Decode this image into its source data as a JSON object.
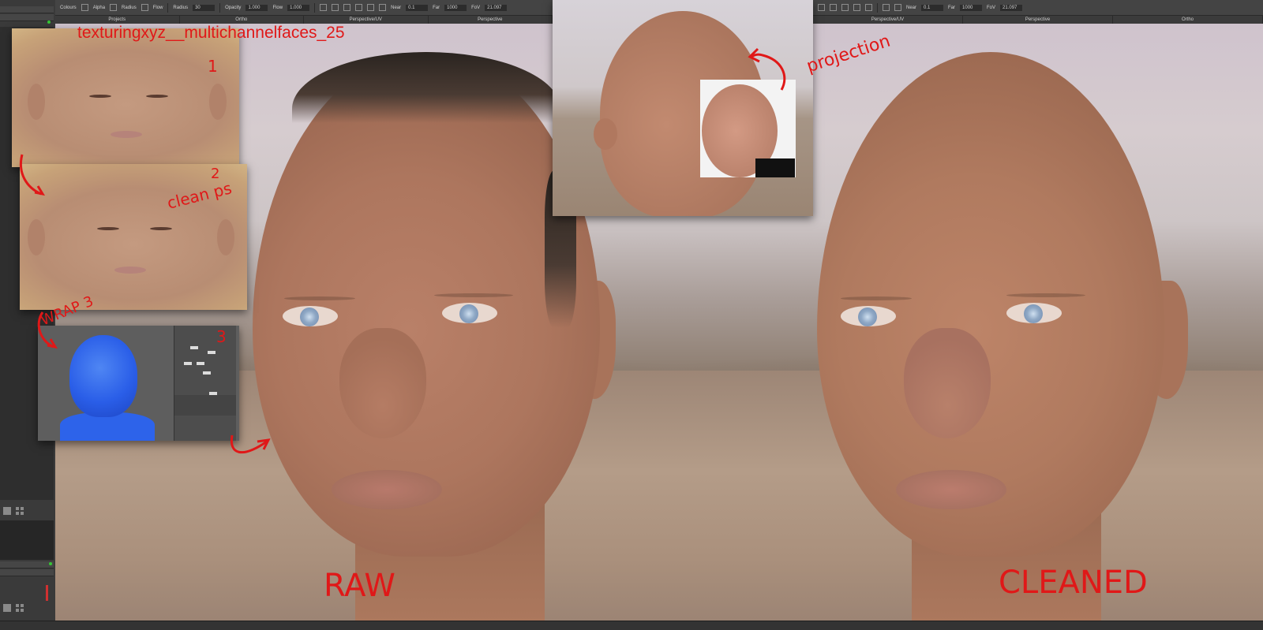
{
  "left_toolbar": {
    "colours_label": "Colours",
    "alpha_label": "Alpha",
    "radius_label": "Radius",
    "flow_label": "Flow",
    "radius2_label": "Radius",
    "radius_value": "30",
    "opacity_label": "Opacity",
    "opacity_value": "1.000",
    "flow2_label": "Flow",
    "flow_value": "1.000",
    "near_label": "Near",
    "near_value": "0.1",
    "far_label": "Far",
    "far_value": "1000",
    "fov_label": "FoV",
    "fov_value": "21.097"
  },
  "left_tabs": [
    "Projects",
    "Ortho",
    "Perspective/UV",
    "Perspective"
  ],
  "right_toolbar": {
    "near_label": "Near",
    "near_value": "0.1",
    "far_label": "Far",
    "far_value": "1000",
    "fov_label": "FoV",
    "fov_value": "21.097"
  },
  "right_tabs": [
    "Perspective/UV",
    "Perspective",
    "Ortho"
  ],
  "overlay_title": "texturingxyz__multichannelfaces_25",
  "annotations": {
    "step1": "1",
    "step2": "2",
    "clean_ps": "clean ps",
    "wrap3": "WRAP 3",
    "step3": "3",
    "projection": "projection",
    "raw": "RAW",
    "cleaned": "CLEANED"
  },
  "colors": {
    "annotation_red": "#e01818",
    "ui_panel": "#3a3a3a",
    "toolbar": "#444444",
    "wrap_blue": "#2a5ee8"
  }
}
